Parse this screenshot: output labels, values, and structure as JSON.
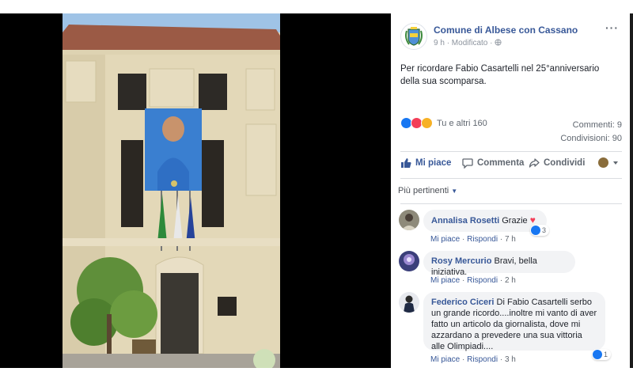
{
  "post": {
    "page_name": "Comune di Albese con Cassano",
    "time": "9 h",
    "edited": "Modificato",
    "more": "···",
    "text": "Per ricordare Fabio Casartelli nel 25°anniversario della sua scomparsa.",
    "reactions_text": "Tu e altri 160",
    "comments_count": "Commenti: 9",
    "shares_count": "Condivisioni: 90"
  },
  "actions": {
    "like": "Mi piace",
    "comment": "Commenta",
    "share": "Condividi"
  },
  "filter": {
    "label": "Più pertinenti"
  },
  "comments": [
    {
      "name": "Annalisa Rosetti",
      "text": "Grazie",
      "like": "Mi piace",
      "reply": "Rispondi",
      "time": "7 h",
      "reactions": "3"
    },
    {
      "name": "Rosy Mercurio",
      "text": "Bravi, bella iniziativa.",
      "like": "Mi piace",
      "reply": "Rispondi",
      "time": "2 h"
    },
    {
      "name": "Federico Ciceri",
      "text": "Di Fabio Casartelli serbo un grande ricordo....inoltre mi vanto di aver fatto un articolo da giornalista, dove mi azzardano a prevedere una sua vittoria alle Olimpiadi....",
      "like": "Mi piace",
      "reply": "Rispondi",
      "time": "3 h",
      "reactions": "1"
    }
  ],
  "colors": {
    "link": "#385898",
    "accent": "#1877f2",
    "meta": "#8d949e",
    "bubble": "#f2f3f5"
  },
  "icons": [
    "globe-icon",
    "like-thumb-icon",
    "comment-bubble-icon",
    "share-arrow-icon",
    "heart-icon",
    "caret-down-icon"
  ]
}
